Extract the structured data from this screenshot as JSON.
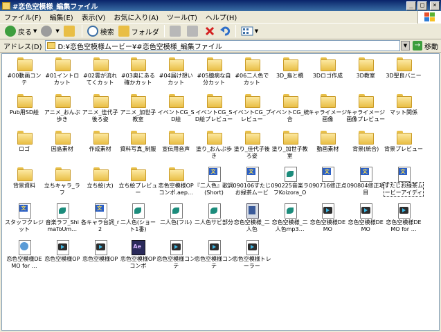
{
  "window": {
    "title": "#恋色空模様_編集ファイル",
    "controls": {
      "minimize": "_",
      "maximize": "□",
      "close": "×"
    }
  },
  "menu": [
    "ファイル(F)",
    "編集(E)",
    "表示(V)",
    "お気に入り(A)",
    "ツール(T)",
    "ヘルプ(H)"
  ],
  "toolbar": {
    "back": "戻る",
    "search": "検索",
    "folders": "フォルダ"
  },
  "address": {
    "label": "アドレス(D)",
    "path": "D:¥恋色空模様ムービー¥#恋色空模様_編集ファイル",
    "go": "移動"
  },
  "files": [
    {
      "label": "#00動画コンテ",
      "type": "folder"
    },
    {
      "label": "#01イントロカット",
      "type": "folder"
    },
    {
      "label": "#02雲が流れてくカット",
      "type": "folder"
    },
    {
      "label": "#03奥にある確かカット",
      "type": "folder"
    },
    {
      "label": "#04届け想いカット",
      "type": "folder"
    },
    {
      "label": "#05臆病な自分カット",
      "type": "folder"
    },
    {
      "label": "#06二人色でカット",
      "type": "folder"
    },
    {
      "label": "3D_島と橋",
      "type": "folder"
    },
    {
      "label": "3Dロゴ作成",
      "type": "folder"
    },
    {
      "label": "3D教室",
      "type": "folder"
    },
    {
      "label": "3D聖良バニー",
      "type": "folder"
    },
    {
      "label": "Pub用SD絵",
      "type": "folder"
    },
    {
      "label": "アニメ_おんぷ歩き",
      "type": "folder"
    },
    {
      "label": "アニメ_佳代子後ろ姿",
      "type": "folder"
    },
    {
      "label": "アニメ_加世子教室",
      "type": "folder"
    },
    {
      "label": "イベントCG_SD絵",
      "type": "folder"
    },
    {
      "label": "イベントCG_SD絵プレビュー",
      "type": "folder"
    },
    {
      "label": "イベントCG_プレビュー",
      "type": "folder"
    },
    {
      "label": "イベントCG_統合",
      "type": "folder"
    },
    {
      "label": "キャライメージ画像",
      "type": "folder"
    },
    {
      "label": "キャライメージ画像プレビュー",
      "type": "folder"
    },
    {
      "label": "マット関係",
      "type": "folder"
    },
    {
      "label": "ロゴ",
      "type": "folder"
    },
    {
      "label": "因島素材",
      "type": "folder"
    },
    {
      "label": "作成素材",
      "type": "folder"
    },
    {
      "label": "資料写真_制服",
      "type": "folder"
    },
    {
      "label": "宣伝用音声",
      "type": "folder"
    },
    {
      "label": "塗り_おんぷ歩き",
      "type": "folder"
    },
    {
      "label": "塗り_佳代子後ろ姿",
      "type": "folder"
    },
    {
      "label": "塗り_加世子教室",
      "type": "folder"
    },
    {
      "label": "動画素材",
      "type": "folder"
    },
    {
      "label": "背景(統合)",
      "type": "folder"
    },
    {
      "label": "背景プレビュー",
      "type": "folder"
    },
    {
      "label": "背景資料",
      "type": "folder"
    },
    {
      "label": "立ちキャラ_ラフ",
      "type": "folder"
    },
    {
      "label": "立ち絵(大)",
      "type": "folder"
    },
    {
      "label": "立ち絵プレビュー",
      "type": "folder"
    },
    {
      "label": "恋色空模様OPコンポ.aep…",
      "type": "folder"
    },
    {
      "label": "『二人色』歌詞(Short)",
      "type": "doc"
    },
    {
      "label": "090106すたじお緑茶ムービー…",
      "type": "doc"
    },
    {
      "label": "090225音楽ラフKoizora_OP…",
      "type": "audio"
    },
    {
      "label": "090716修正点",
      "type": "doc"
    },
    {
      "label": "090804修正項目",
      "type": "doc"
    },
    {
      "label": "すたじお緑茶ムービーアイディア",
      "type": "doc",
      "selected": true
    },
    {
      "label": "スタッフクレジット",
      "type": "doc"
    },
    {
      "label": "音楽ラフ_ShimaToUm…",
      "type": "audio"
    },
    {
      "label": "各キャラ台詞_r2",
      "type": "doc"
    },
    {
      "label": "二人色(ショート1番)",
      "type": "audio"
    },
    {
      "label": "二人色(フル)",
      "type": "audio"
    },
    {
      "label": "二人色サビ部分",
      "type": "audio"
    },
    {
      "label": "恋色空模様_二人色",
      "type": "installer"
    },
    {
      "label": "恋色空模様_二人色mp3…",
      "type": "audio"
    },
    {
      "label": "恋色空模様DEMO",
      "type": "video"
    },
    {
      "label": "恋色空模様DEMO",
      "type": "video"
    },
    {
      "label": "恋色空模様DEMO for …",
      "type": "video"
    },
    {
      "label": "恋色空模様DEMO for …",
      "type": "movie"
    },
    {
      "label": "恋色空模様OP",
      "type": "video"
    },
    {
      "label": "恋色空模様OP",
      "type": "video"
    },
    {
      "label": "恋色空模様OPコンポ",
      "type": "ae"
    },
    {
      "label": "恋色空模様コンテ",
      "type": "video"
    },
    {
      "label": "恋色空模様コンテ",
      "type": "video"
    },
    {
      "label": "恋色空模様トレーラー",
      "type": "video"
    }
  ]
}
